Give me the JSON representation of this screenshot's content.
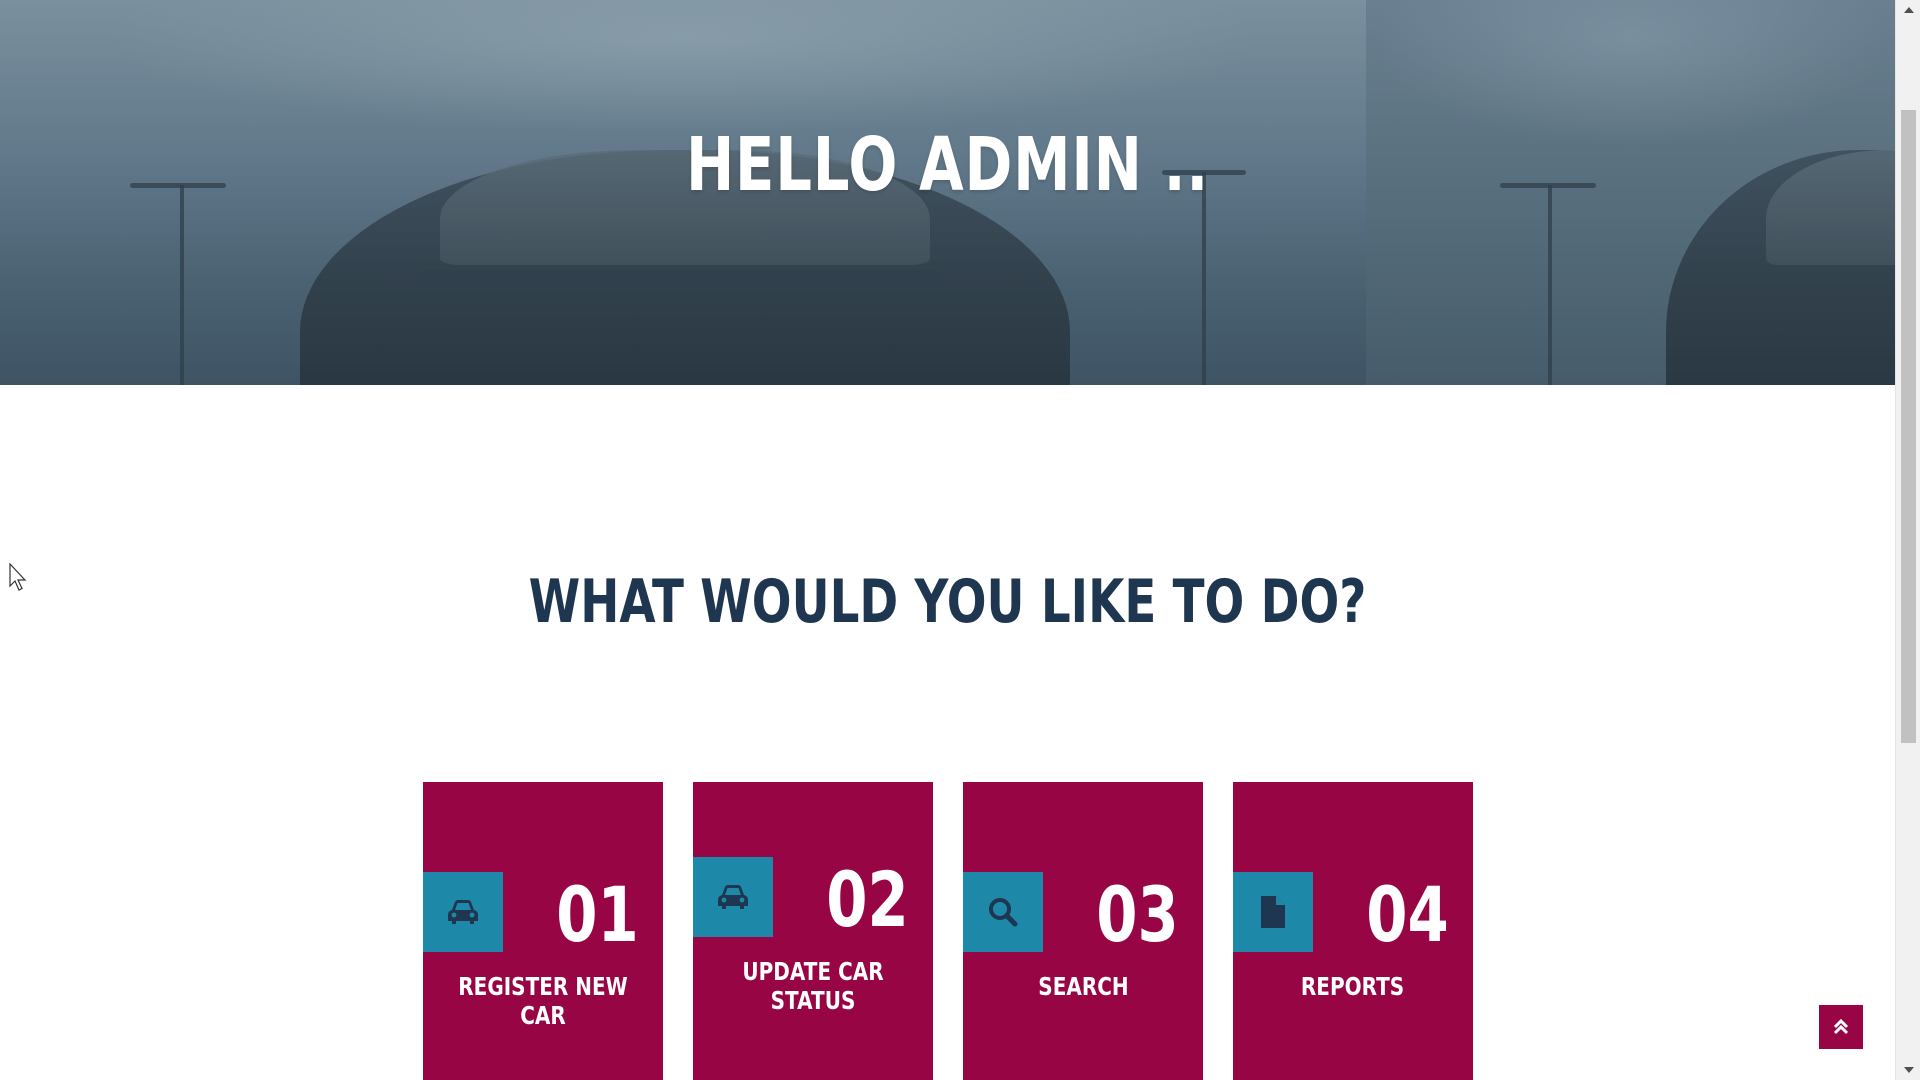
{
  "hero": {
    "title": "HELLO ADMIN .."
  },
  "main": {
    "heading": "WHAT WOULD YOU LIKE TO DO?"
  },
  "cards": [
    {
      "number": "01",
      "label": "REGISTER NEW CAR",
      "icon": "car-icon"
    },
    {
      "number": "02",
      "label": "UPDATE CAR STATUS",
      "icon": "car-icon"
    },
    {
      "number": "03",
      "label": "SEARCH",
      "icon": "search-icon"
    },
    {
      "number": "04",
      "label": "REPORTS",
      "icon": "file-icon"
    }
  ],
  "back_to_top": {
    "icon": "double-chevron-up-icon"
  },
  "colors": {
    "card_background": "#970545",
    "icon_tile": "#1e88a8",
    "heading": "#1f3651",
    "icon_glyph": "#1f3651",
    "hero_overlay": "#5a7283"
  }
}
